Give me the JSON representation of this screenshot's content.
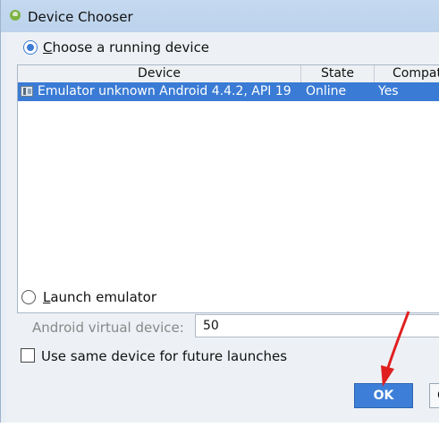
{
  "window": {
    "title": "Device Chooser"
  },
  "choose_running": {
    "label_first": "C",
    "label_rest": "hoose a running device",
    "selected": true
  },
  "table": {
    "columns": [
      "Device",
      "State",
      "Compatible"
    ],
    "rows": [
      {
        "device": "Emulator unknown Android 4.4.2, API 19",
        "state": "Online",
        "compatible": "Yes",
        "selected": true
      }
    ]
  },
  "launch_emulator": {
    "label_first": "L",
    "label_rest": "aunch emulator",
    "selected": false
  },
  "avd": {
    "label": "Android virtual device:",
    "value": "50"
  },
  "same_device": {
    "label": "Use same device for future launches",
    "checked": false
  },
  "buttons": {
    "ok": "OK",
    "cancel": "C"
  },
  "colors": {
    "accent": "#3a7bd5",
    "arrow": "#e02020"
  }
}
